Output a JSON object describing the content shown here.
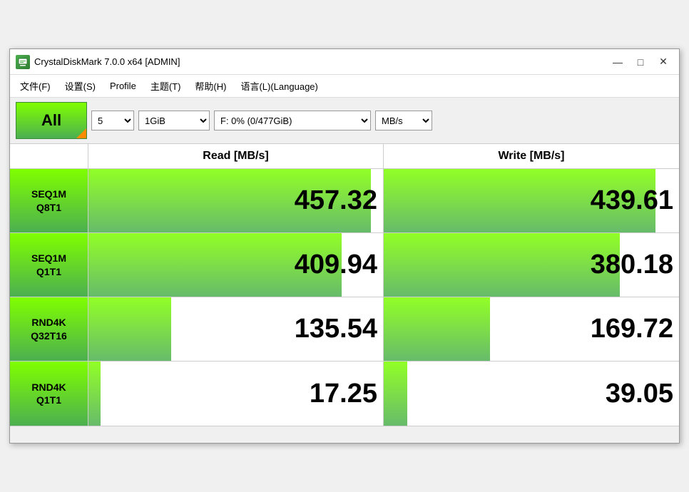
{
  "window": {
    "title": "CrystalDiskMark 7.0.0 x64 [ADMIN]",
    "icon": "disk-icon"
  },
  "menu": {
    "items": [
      {
        "label": "文件(F)"
      },
      {
        "label": "设置(S)"
      },
      {
        "label": "Profile"
      },
      {
        "label": "主题(T)"
      },
      {
        "label": "帮助(H)"
      },
      {
        "label": "语言(L)(Language)"
      }
    ]
  },
  "toolbar": {
    "all_button": "All",
    "count_value": "5",
    "size_value": "1GiB",
    "drive_value": "F: 0% (0/477GiB)",
    "unit_value": "MB/s"
  },
  "results": {
    "read_header": "Read [MB/s]",
    "write_header": "Write [MB/s]",
    "rows": [
      {
        "label_line1": "SEQ1M",
        "label_line2": "Q8T1",
        "read_value": "457.32",
        "write_value": "439.61",
        "read_bar_pct": 96,
        "write_bar_pct": 92
      },
      {
        "label_line1": "SEQ1M",
        "label_line2": "Q1T1",
        "read_value": "409.94",
        "write_value": "380.18",
        "read_bar_pct": 86,
        "write_bar_pct": 80
      },
      {
        "label_line1": "RND4K",
        "label_line2": "Q32T16",
        "read_value": "135.54",
        "write_value": "169.72",
        "read_bar_pct": 28,
        "write_bar_pct": 36
      },
      {
        "label_line1": "RND4K",
        "label_line2": "Q1T1",
        "read_value": "17.25",
        "write_value": "39.05",
        "read_bar_pct": 4,
        "write_bar_pct": 8
      }
    ]
  },
  "colors": {
    "bar_green_start": "#7fff00",
    "bar_green_end": "#4caf50",
    "accent_orange": "#ff8c00"
  }
}
